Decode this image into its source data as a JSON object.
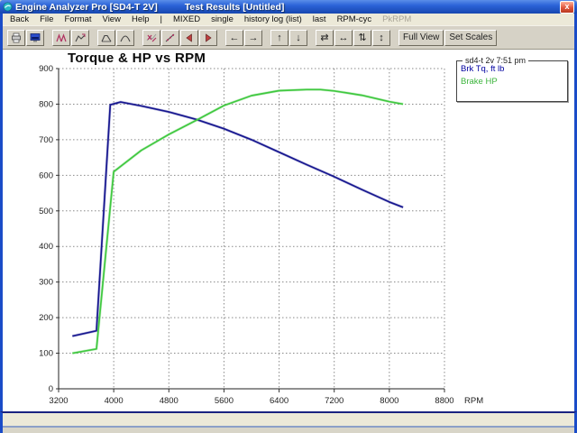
{
  "window": {
    "title_app": "Engine Analyzer Pro [SD4-T 2V]",
    "title_doc": "Test Results [Untitled]",
    "close_glyph": "x"
  },
  "menu": {
    "items": [
      {
        "label": "Back"
      },
      {
        "label": "File"
      },
      {
        "label": "Format"
      },
      {
        "label": "View"
      },
      {
        "label": "Help"
      },
      {
        "label": "|",
        "separator": true
      },
      {
        "label": "MIXED"
      },
      {
        "label": "single"
      },
      {
        "label": "history log (list)"
      },
      {
        "label": "last"
      },
      {
        "label": "RPM-cyc"
      },
      {
        "label": "PkRPM",
        "disabled": true
      }
    ]
  },
  "toolbar": {
    "groups": [
      {
        "buttons": [
          {
            "name": "print-button",
            "icon": "printer-icon"
          },
          {
            "name": "screen-view-button",
            "icon": "monitor-icon"
          }
        ]
      },
      {
        "buttons": [
          {
            "name": "multi-plot-button",
            "icon": "multi-plot-icon"
          },
          {
            "name": "zoom-plot-button",
            "icon": "zoom-plot-icon"
          }
        ]
      },
      {
        "buttons": [
          {
            "name": "peak-curve-button",
            "icon": "peak-curve-icon"
          },
          {
            "name": "dome-curve-button",
            "icon": "dome-curve-icon"
          }
        ]
      },
      {
        "buttons": [
          {
            "name": "compare-plot-button",
            "icon": "compare-plot-icon"
          },
          {
            "name": "line-plot-button",
            "icon": "line-plot-icon"
          },
          {
            "name": "history-prev-button",
            "icon": "red-left-arrow-icon"
          },
          {
            "name": "history-next-button",
            "icon": "red-right-arrow-icon"
          }
        ]
      },
      {
        "buttons": [
          {
            "name": "pan-left-button",
            "glyph": "←"
          },
          {
            "name": "pan-right-button",
            "glyph": "→"
          }
        ]
      },
      {
        "buttons": [
          {
            "name": "pan-up-button",
            "glyph": "↑"
          },
          {
            "name": "pan-down-button",
            "glyph": "↓"
          }
        ]
      },
      {
        "buttons": [
          {
            "name": "compress-x-button",
            "glyph": "⇄"
          },
          {
            "name": "expand-x-button",
            "glyph": "↔"
          },
          {
            "name": "compress-y-button",
            "glyph": "⇅"
          },
          {
            "name": "expand-y-button",
            "glyph": "↕"
          }
        ]
      },
      {
        "buttons": [
          {
            "name": "full-view-button",
            "label": "Full View"
          },
          {
            "name": "set-scales-button",
            "label": "Set Scales"
          }
        ]
      }
    ]
  },
  "legend": {
    "caption": "sd4-t 2v 7:51 pm",
    "items": [
      {
        "label": "Brk Tq, ft lb",
        "color": "#0000a0"
      },
      {
        "label": "Brake HP",
        "color": "#3cb43c"
      }
    ]
  },
  "chart_data": {
    "type": "line",
    "title": "Torque & HP vs RPM",
    "xlabel": "RPM",
    "ylabel": "",
    "xlim": [
      3200,
      8800
    ],
    "ylim": [
      0,
      900
    ],
    "x_ticks": [
      3200,
      4000,
      4800,
      5600,
      6400,
      7200,
      8000,
      8800
    ],
    "y_ticks": [
      0,
      100,
      200,
      300,
      400,
      500,
      600,
      700,
      800,
      900
    ],
    "grid": "dotted",
    "legend_position": "top-right",
    "series": [
      {
        "name": "Brk Tq, ft lb",
        "color": "#16168f",
        "x": [
          3400,
          3750,
          3950,
          4100,
          4400,
          4800,
          5200,
          5600,
          6000,
          6400,
          6800,
          7200,
          7600,
          8000,
          8200
        ],
        "values": [
          148,
          163,
          798,
          806,
          795,
          778,
          757,
          731,
          700,
          665,
          630,
          596,
          560,
          525,
          510
        ]
      },
      {
        "name": "Brake HP",
        "color": "#3fc83f",
        "x": [
          3400,
          3750,
          4000,
          4400,
          4800,
          5200,
          5600,
          6000,
          6400,
          6800,
          7000,
          7200,
          7600,
          8000,
          8200
        ],
        "values": [
          100,
          112,
          610,
          670,
          715,
          755,
          796,
          824,
          838,
          841,
          841,
          837,
          825,
          807,
          800
        ]
      }
    ]
  }
}
